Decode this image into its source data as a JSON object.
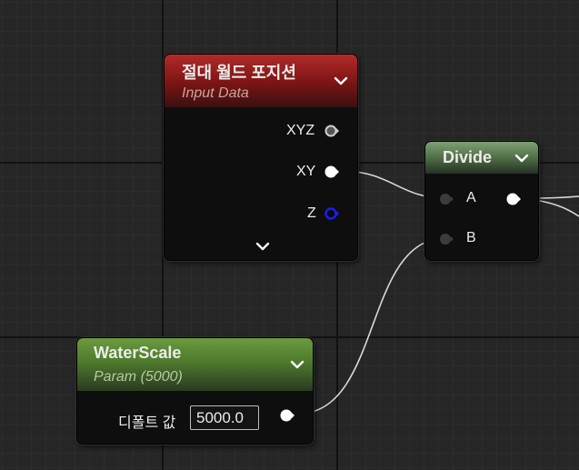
{
  "nodes": {
    "absolute_world_position": {
      "title": "절대 월드 포지션",
      "subtitle": "Input Data",
      "outputs": [
        "XYZ",
        "XY",
        "Z"
      ]
    },
    "divide": {
      "title": "Divide",
      "inputs": [
        "A",
        "B"
      ]
    },
    "water_scale": {
      "title": "WaterScale",
      "subtitle": "Param (5000)",
      "default_label": "디폴트 값",
      "default_value": "5000.0"
    }
  },
  "colors": {
    "input_data_header": "#8e1e1e",
    "param_header": "#4e7a2c",
    "divide_header": "#4f6f46",
    "z_pin": "#1a1aff",
    "wire": "#d8d8d8"
  },
  "icons": {
    "collapse": "chevron-down-icon",
    "expand": "chevron-down-icon",
    "pin": "exec-pin-icon"
  }
}
